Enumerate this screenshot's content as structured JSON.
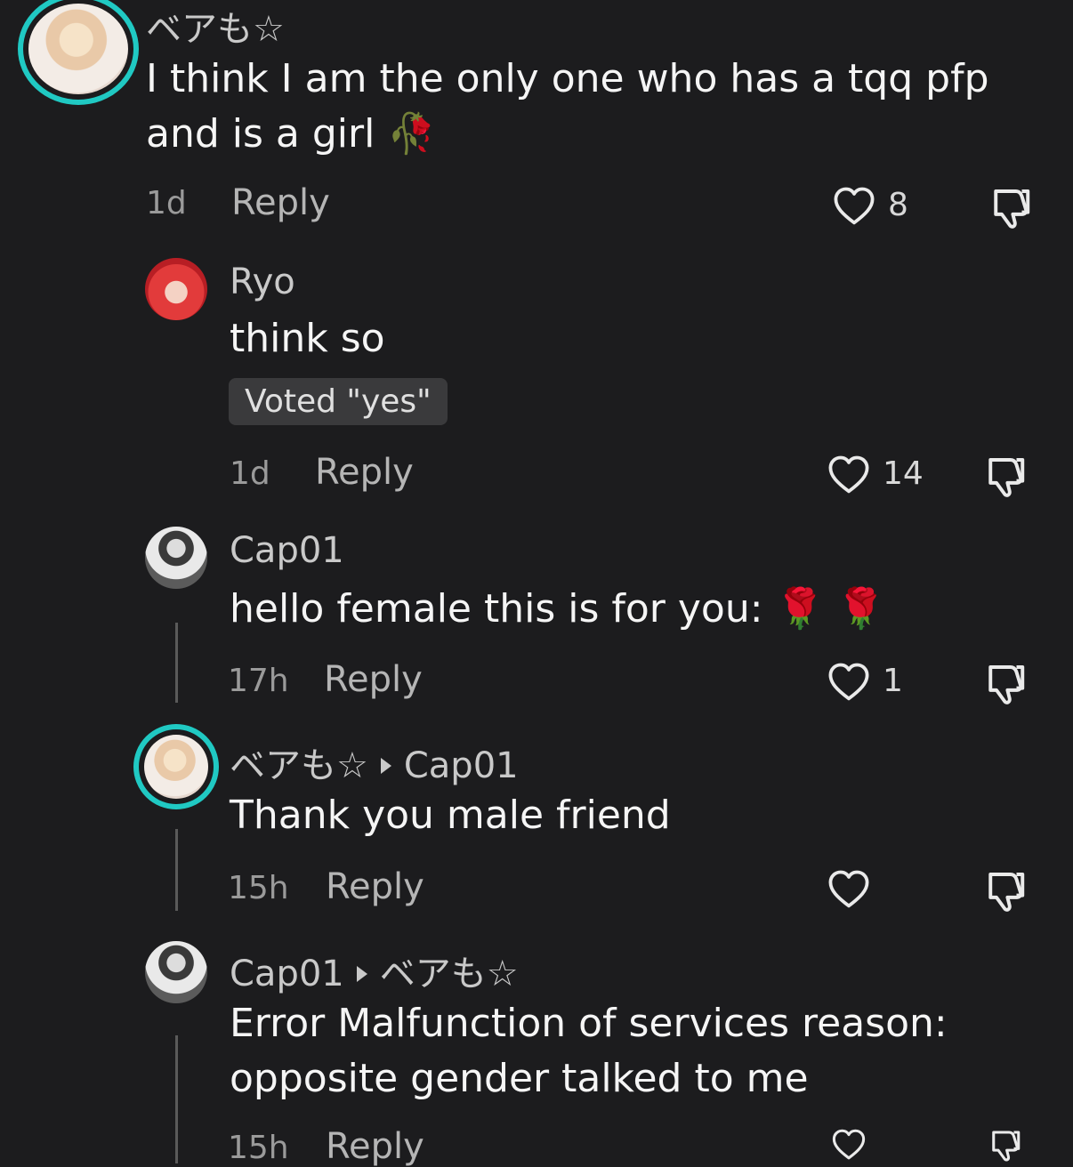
{
  "accent_ring_color": "#20c9c3",
  "comments": [
    {
      "username": "ベアも☆",
      "text_line1": "I think I am the only one who has a tqq pfp",
      "text_line2": "and is a girl 🥀",
      "time": "1d",
      "reply_label": "Reply",
      "likes": "8"
    },
    {
      "username": "Ryo",
      "text": "think so",
      "vote_badge": "Voted \"yes\"",
      "time": "1d",
      "reply_label": "Reply",
      "likes": "14"
    },
    {
      "username": "Cap01",
      "text": "hello female this is for you: 🌹 🌹",
      "time": "17h",
      "reply_label": "Reply",
      "likes": "1"
    },
    {
      "username": "ベアも☆",
      "reply_to": "Cap01",
      "text": "Thank you male friend",
      "time": "15h",
      "reply_label": "Reply",
      "likes": ""
    },
    {
      "username": "Cap01",
      "reply_to": "ベアも☆",
      "text_line1": "Error Malfunction of services reason:",
      "text_line2": "opposite gender talked to me",
      "time": "15h",
      "reply_label": "Reply",
      "likes": ""
    }
  ],
  "icons": {
    "like": "heart-outline-icon",
    "dislike": "thumbs-down-outline-icon"
  }
}
